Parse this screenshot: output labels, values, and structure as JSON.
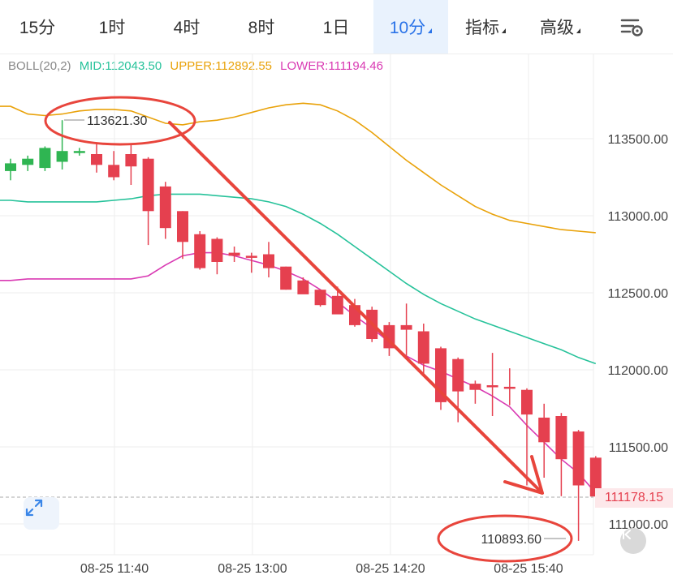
{
  "toolbar": {
    "tabs": [
      {
        "label": "15分"
      },
      {
        "label": "1时"
      },
      {
        "label": "4时"
      },
      {
        "label": "8时"
      },
      {
        "label": "1日"
      },
      {
        "label": "10分"
      },
      {
        "label": "指标"
      },
      {
        "label": "高级"
      }
    ],
    "active_tab": "10分",
    "settings_icon": "chart-settings-icon"
  },
  "indicator": {
    "name": "BOLL(20,2)",
    "mid": "MID:112043.50",
    "upper": "UPPER:112892.55",
    "lower": "LOWER:111194.46",
    "colors": {
      "name": "#888888",
      "mid": "#26c29a",
      "upper": "#e9a20a",
      "lower": "#d93ab3"
    }
  },
  "chart_data": {
    "type": "candlestick",
    "y_axis": {
      "ticks": [
        113500,
        113000,
        112500,
        112000,
        111500,
        111000
      ],
      "labels": [
        "113500.00",
        "113000.00",
        "112500.00",
        "112000.00",
        "111500.00",
        "111000.00"
      ]
    },
    "x_axis": {
      "labels": [
        "08-25 11:40",
        "08-25 13:00",
        "08-25 14:20",
        "08-25 15:40"
      ]
    },
    "current_price": "111178.15",
    "annotations": {
      "high": "113621.30",
      "low": "110893.60"
    },
    "colors": {
      "up": "#2fb552",
      "down": "#e5404f",
      "grid": "#eeeeee",
      "arrow": "#e8453c"
    },
    "candles": [
      {
        "o": 113290,
        "h": 113370,
        "l": 113230,
        "c": 113340
      },
      {
        "o": 113330,
        "h": 113390,
        "l": 113290,
        "c": 113370
      },
      {
        "o": 113310,
        "h": 113450,
        "l": 113290,
        "c": 113440
      },
      {
        "o": 113350,
        "h": 113620,
        "l": 113300,
        "c": 113420
      },
      {
        "o": 113420,
        "h": 113440,
        "l": 113390,
        "c": 113420
      },
      {
        "o": 113400,
        "h": 113470,
        "l": 113280,
        "c": 113330
      },
      {
        "o": 113330,
        "h": 113420,
        "l": 113230,
        "c": 113250
      },
      {
        "o": 113400,
        "h": 113460,
        "l": 113200,
        "c": 113320
      },
      {
        "o": 113370,
        "h": 113380,
        "l": 112810,
        "c": 113030
      },
      {
        "o": 113190,
        "h": 113220,
        "l": 112850,
        "c": 112920
      },
      {
        "o": 113030,
        "h": 113030,
        "l": 112720,
        "c": 112830
      },
      {
        "o": 112880,
        "h": 112900,
        "l": 112650,
        "c": 112660
      },
      {
        "o": 112850,
        "h": 112860,
        "l": 112620,
        "c": 112700
      },
      {
        "o": 112760,
        "h": 112800,
        "l": 112700,
        "c": 112740
      },
      {
        "o": 112740,
        "h": 112760,
        "l": 112630,
        "c": 112730
      },
      {
        "o": 112750,
        "h": 112830,
        "l": 112600,
        "c": 112660
      },
      {
        "o": 112670,
        "h": 112670,
        "l": 112520,
        "c": 112520
      },
      {
        "o": 112580,
        "h": 112600,
        "l": 112500,
        "c": 112490
      },
      {
        "o": 112520,
        "h": 112520,
        "l": 112410,
        "c": 112420
      },
      {
        "o": 112480,
        "h": 112540,
        "l": 112380,
        "c": 112360
      },
      {
        "o": 112420,
        "h": 112460,
        "l": 112280,
        "c": 112290
      },
      {
        "o": 112390,
        "h": 112410,
        "l": 112180,
        "c": 112200
      },
      {
        "o": 112290,
        "h": 112310,
        "l": 112090,
        "c": 112140
      },
      {
        "o": 112290,
        "h": 112430,
        "l": 112080,
        "c": 112260
      },
      {
        "o": 112250,
        "h": 112300,
        "l": 111970,
        "c": 112040
      },
      {
        "o": 112140,
        "h": 112150,
        "l": 111740,
        "c": 111790
      },
      {
        "o": 112070,
        "h": 112080,
        "l": 111660,
        "c": 111860
      },
      {
        "o": 111910,
        "h": 111930,
        "l": 111780,
        "c": 111870
      },
      {
        "o": 111900,
        "h": 112110,
        "l": 111700,
        "c": 111890
      },
      {
        "o": 111890,
        "h": 112010,
        "l": 111770,
        "c": 111880
      },
      {
        "o": 111870,
        "h": 111880,
        "l": 111250,
        "c": 111710
      },
      {
        "o": 111690,
        "h": 111780,
        "l": 111300,
        "c": 111530
      },
      {
        "o": 111700,
        "h": 111720,
        "l": 111180,
        "c": 111420
      },
      {
        "o": 111600,
        "h": 111610,
        "l": 110890,
        "c": 111250
      },
      {
        "o": 111430,
        "h": 111440,
        "l": 111150,
        "c": 111178
      }
    ]
  }
}
